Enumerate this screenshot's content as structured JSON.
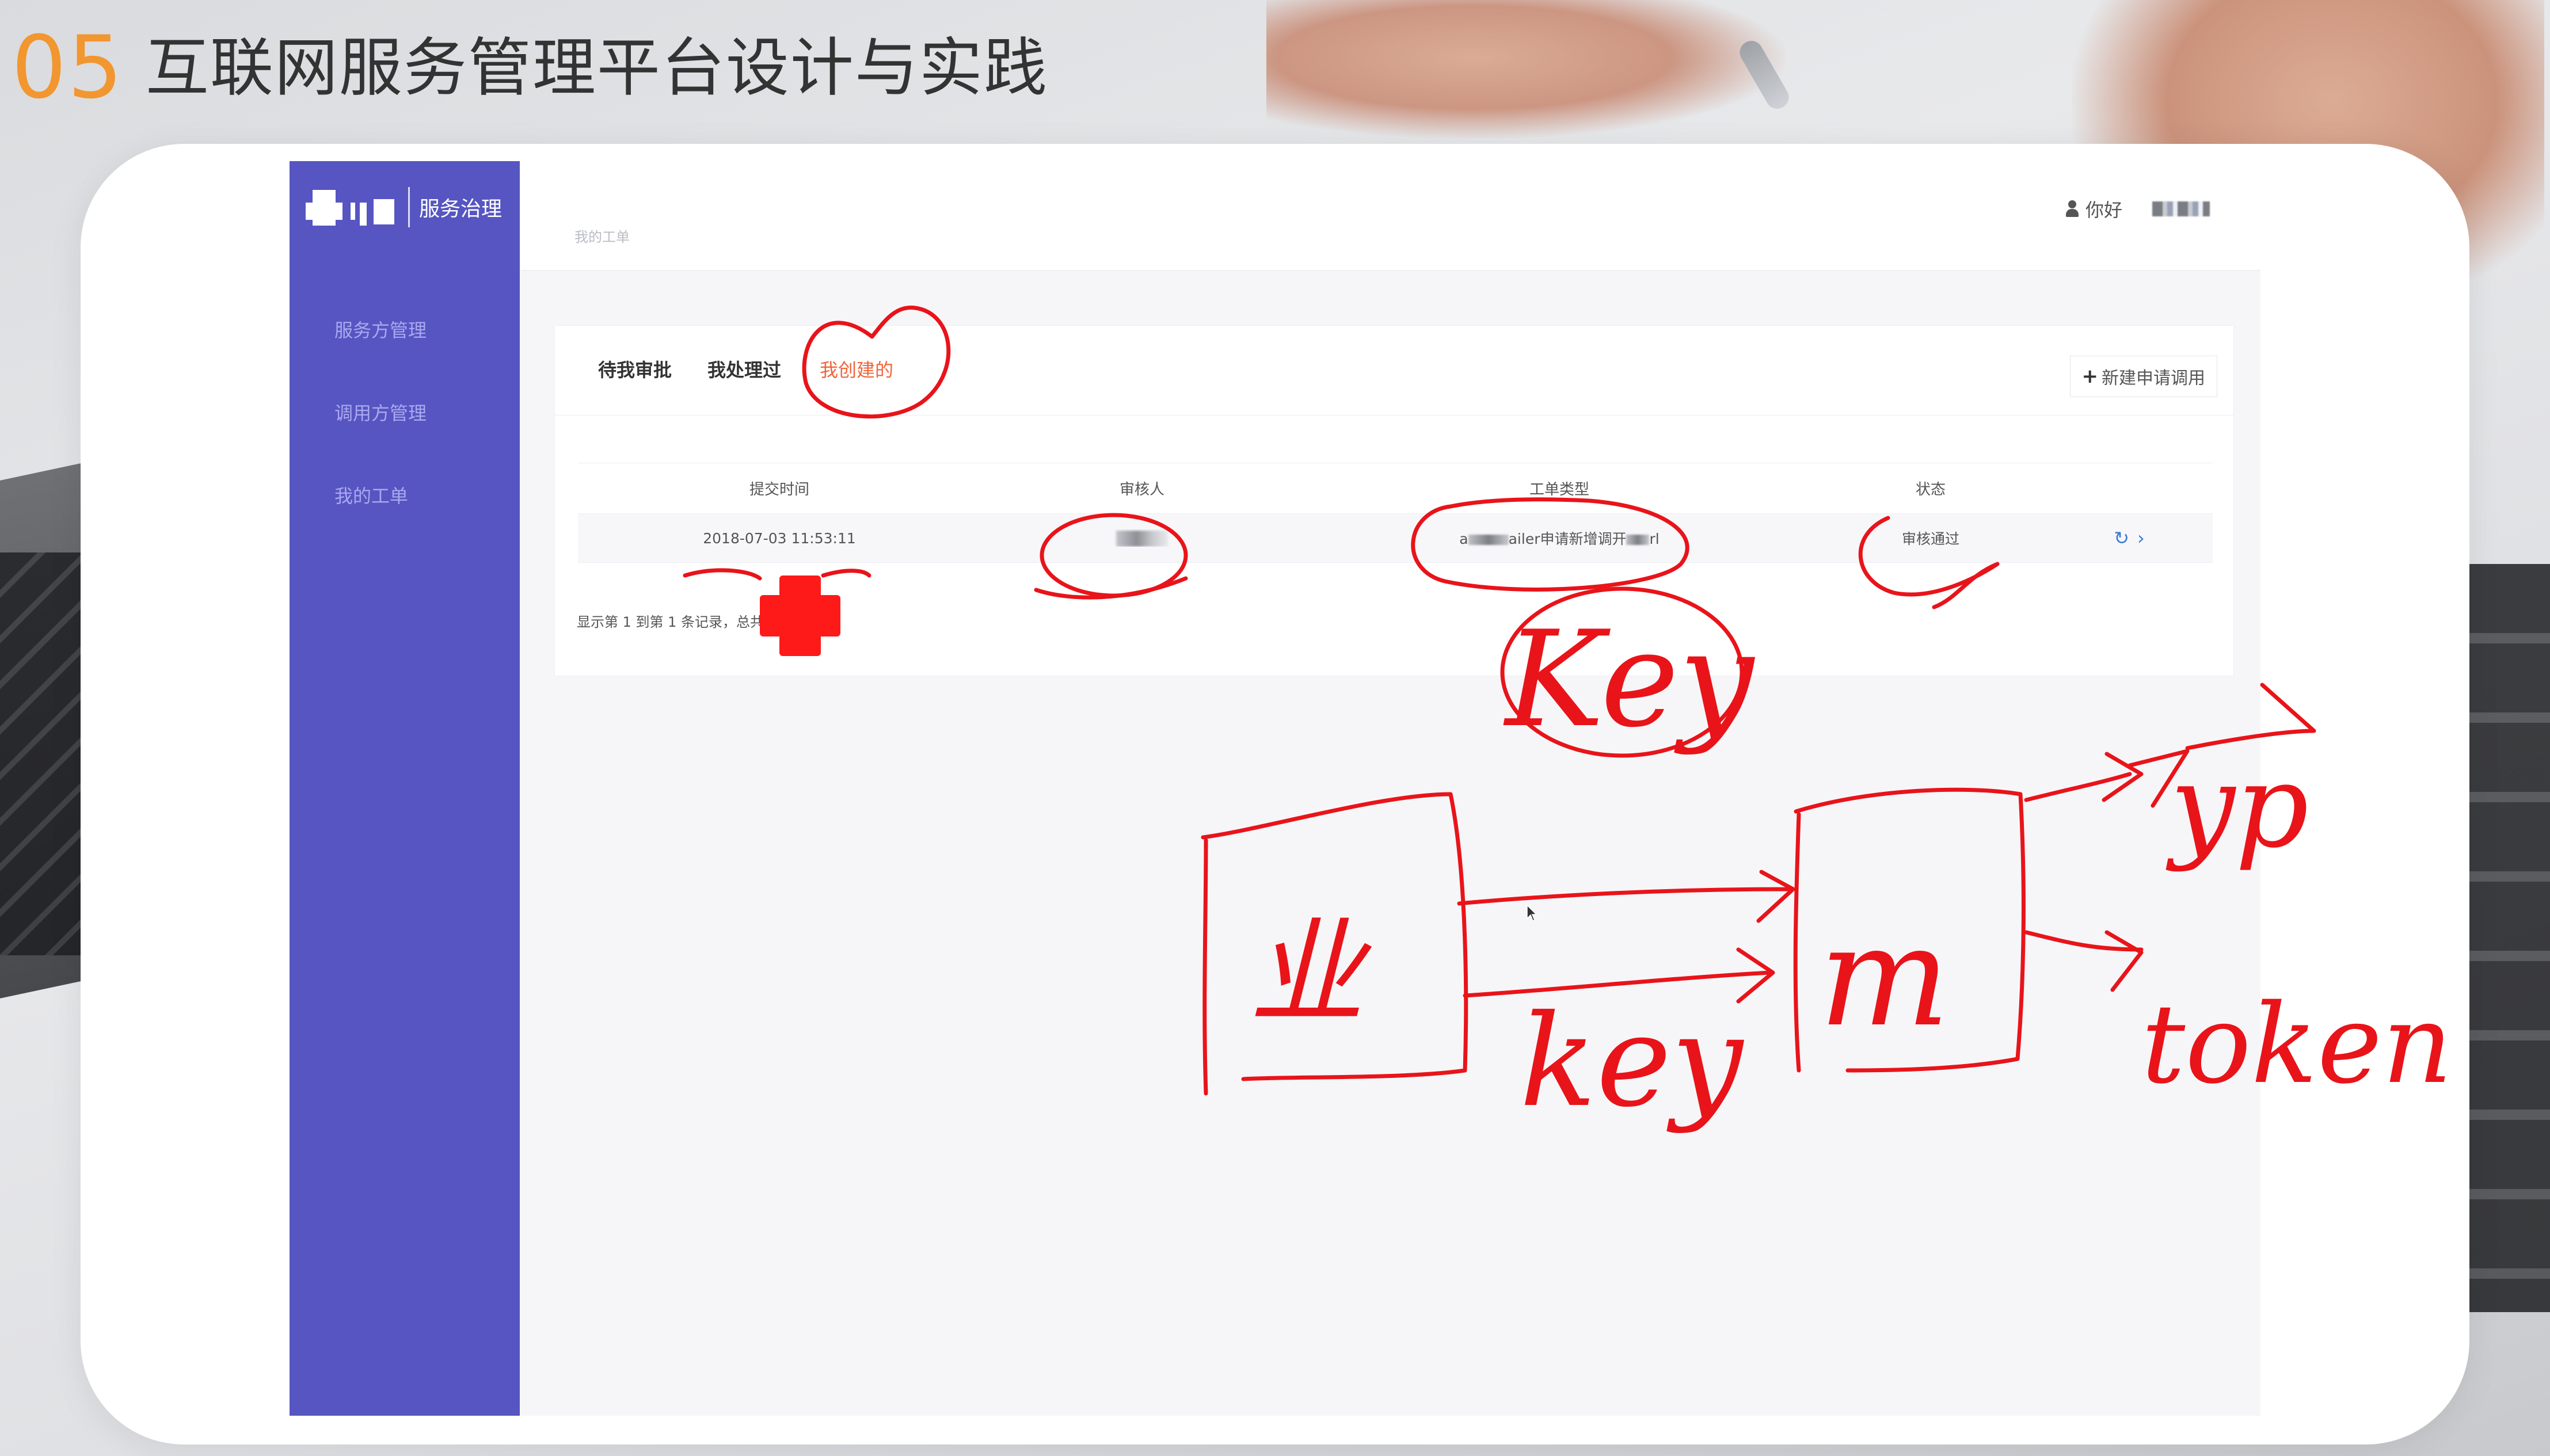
{
  "slide": {
    "number": "05",
    "title": "互联网服务管理平台设计与实践"
  },
  "app": {
    "brand_text": "服务治理",
    "nav": [
      {
        "label": "服务方管理"
      },
      {
        "label": "调用方管理"
      },
      {
        "label": "我的工单"
      }
    ],
    "breadcrumb": "我的工单",
    "user_greeting": "你好",
    "tabs": [
      {
        "label": "待我审批",
        "active": false
      },
      {
        "label": "我处理过",
        "active": false
      },
      {
        "label": "我创建的",
        "active": true
      }
    ],
    "new_button_label": "新建申请调用",
    "table": {
      "headers": [
        "提交时间",
        "审核人",
        "工单类型",
        "状态",
        ""
      ],
      "rows": [
        {
          "submit_time": "2018-07-03 11:53:11",
          "type_prefix": "a",
          "type_mid": "ailer申请新增调开",
          "type_suffix": "rl",
          "status": "审核通过"
        }
      ]
    },
    "pager_text": "显示第 1 到第 1 条记录，总共"
  },
  "annotations": {
    "words": [
      "Key",
      "key",
      "token"
    ],
    "color": "#e8141a"
  },
  "colors": {
    "sidebar": "#5655c1",
    "accent_tab": "#f0643c",
    "slide_number": "#f2962f"
  }
}
